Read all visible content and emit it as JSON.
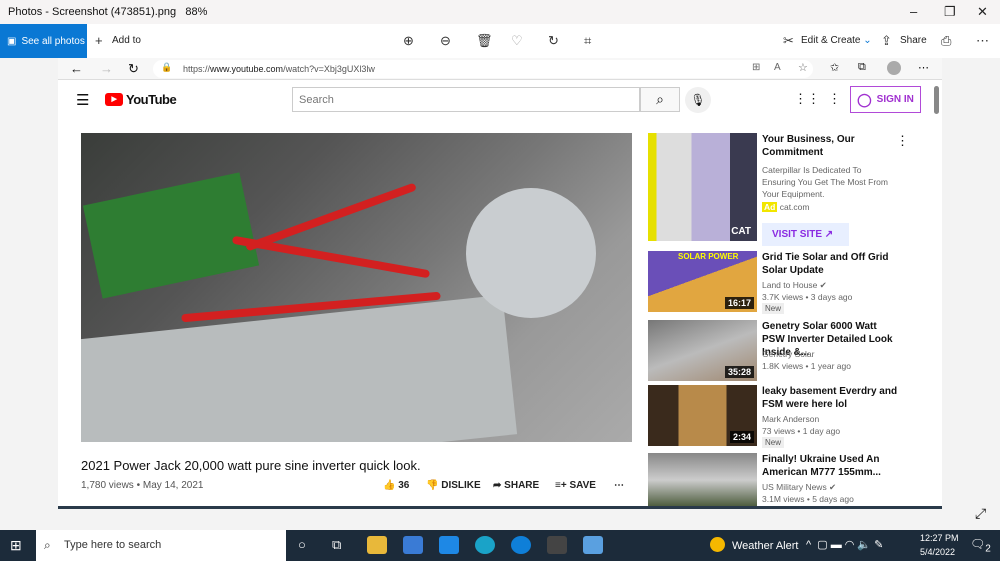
{
  "photos": {
    "title": "Photos - Screenshot (473851).png",
    "zoom": "88%",
    "see_all": "See all photos",
    "add_to": "Add to",
    "edit_create": "Edit & Create",
    "share": "Share"
  },
  "browser": {
    "url_prefix": "https://",
    "url_host": "www.youtube.com",
    "url_path": "/watch?v=Xbj3gUXl3lw"
  },
  "youtube": {
    "logo": "YouTube",
    "search_placeholder": "Search",
    "sign_in": "SIGN IN",
    "video": {
      "title": "2021 Power Jack 20,000 watt pure sine inverter quick look.",
      "views": "1,780 views • May 14, 2021",
      "likes": "36",
      "dislike": "DISLIKE",
      "share": "SHARE",
      "save": "SAVE"
    },
    "ad": {
      "title": "Your Business, Our Commitment",
      "desc": "Caterpillar Is Dedicated To Ensuring You Get The Most From Your Equipment.",
      "badge": "Ad",
      "domain": "cat.com",
      "cta": "VISIT SITE",
      "brand": "CAT"
    },
    "related": [
      {
        "title": "Grid Tie Solar and Off Grid Solar Update",
        "channel": "Land to House ✔",
        "meta": "3.7K views • 3 days ago",
        "badge": "New",
        "duration": "16:17",
        "thumb_text": "SOLAR POWER"
      },
      {
        "title": "Genetry Solar 6000 Watt PSW Inverter Detailed Look Inside &...",
        "channel": "Genetry Solar",
        "meta": "1.8K views • 1 year ago",
        "duration": "35:28"
      },
      {
        "title": "leaky basement Everdry and FSM were here lol",
        "channel": "Mark Anderson",
        "meta": "73 views • 1 day ago",
        "badge": "New",
        "duration": "2:34"
      },
      {
        "title": "Finally! Ukraine Used An American M777 155mm...",
        "channel": "US Military News ✔",
        "meta": "3.1M views • 5 days ago"
      }
    ]
  },
  "taskbar": {
    "search": "Type here to search",
    "weather": "Weather Alert",
    "time": "12:27 PM",
    "date": "5/4/2022",
    "notifications": "2"
  }
}
